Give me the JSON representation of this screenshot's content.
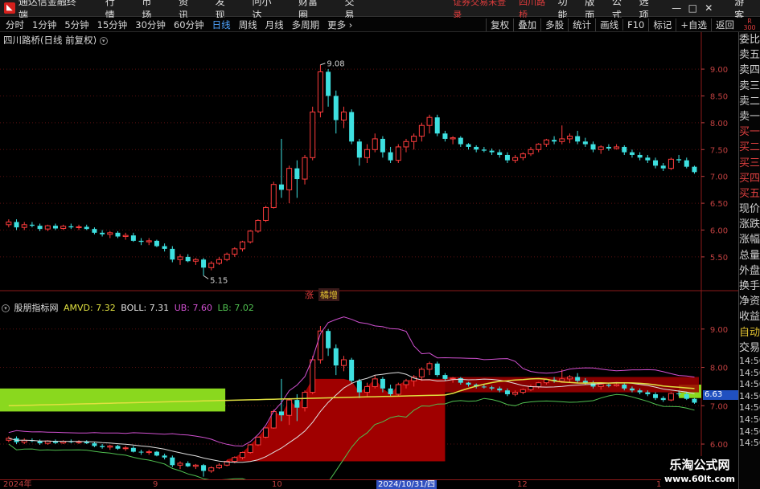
{
  "app": {
    "title": "通达信金融终端",
    "menus": [
      "行情",
      "市场",
      "资讯",
      "发现",
      "问小达",
      "财富圈",
      "交易"
    ],
    "status": "证券交易未登录",
    "stock_name": "四川路桥",
    "right_menus": [
      "功能",
      "版面",
      "公式",
      "选项"
    ],
    "window_controls": [
      "—",
      "□",
      "✕"
    ],
    "guest": "游客"
  },
  "periods": [
    "分时",
    "1分钟",
    "5分钟",
    "15分钟",
    "30分钟",
    "60分钟",
    "日线",
    "周线",
    "月线",
    "多周期",
    "更多 ›"
  ],
  "active_period": "日线",
  "tools": [
    "复权",
    "叠加",
    "多股",
    "统计",
    "画线",
    "F10",
    "标记",
    "+自选",
    "返回"
  ],
  "corner": {
    "top": "R",
    "bottom": "300"
  },
  "main_title": "四川路桥(日线 前复权)",
  "indicator": {
    "name": "股朋指标网",
    "amvd": "AMVD: 7.32",
    "boll": "BOLL: 7.31",
    "ub": "UB: 7.60",
    "lb": "LB: 7.02",
    "colors": {
      "name": "#e0e0e0",
      "amvd": "#e0e040",
      "boll": "#e0e0e0",
      "ub": "#d050d0",
      "lb": "#50c050"
    }
  },
  "badges": {
    "zhang": "涨",
    "nuoz": "橘增"
  },
  "current_price_label": "6.63",
  "right_panel": {
    "labels": [
      "委比",
      "卖五",
      "卖四",
      "卖三",
      "卖二",
      "卖一",
      "买一",
      "买二",
      "买三",
      "买四",
      "买五",
      "现价",
      "涨跌",
      "涨幅",
      "总量",
      "外盘",
      "换手",
      "净资",
      "收益"
    ],
    "auto": "自动",
    "trade": "交易",
    "times": [
      "14:56",
      "14:56",
      "14:56",
      "14:56",
      "14:56",
      "14:56",
      "14:56",
      "14:56"
    ]
  },
  "date_axis": {
    "ticks": [
      {
        "label": "2024年",
        "pos": 0.004
      },
      {
        "label": "9",
        "pos": 0.206
      },
      {
        "label": "10",
        "pos": 0.368
      },
      {
        "label": "12",
        "pos": 0.7
      },
      {
        "label": "1",
        "pos": 0.888
      }
    ],
    "cursor": "2024/10/31/四"
  },
  "watermark": {
    "title": "乐淘公式网",
    "url": "www.60lt.com"
  },
  "chart_data": {
    "type": "candlestick",
    "price_axis_main": {
      "ticks": [
        9.0,
        8.5,
        8.0,
        7.5,
        7.0,
        6.5,
        6.0,
        5.5
      ],
      "range": [
        4.9,
        9.45
      ]
    },
    "price_axis_ind": {
      "ticks": [
        9.0,
        8.0,
        7.0,
        6.0
      ],
      "range": [
        5.1,
        9.75
      ]
    },
    "annotations": {
      "high": "9.08",
      "low": "5.15"
    },
    "candles": [
      [
        6.1,
        6.2,
        6.05,
        6.15
      ],
      [
        6.15,
        6.2,
        6.0,
        6.05
      ],
      [
        6.05,
        6.15,
        6.0,
        6.1
      ],
      [
        6.1,
        6.15,
        6.05,
        6.08
      ],
      [
        6.08,
        6.12,
        5.98,
        6.02
      ],
      [
        6.02,
        6.1,
        5.98,
        6.08
      ],
      [
        6.08,
        6.12,
        6.0,
        6.03
      ],
      [
        6.03,
        6.1,
        6.0,
        6.07
      ],
      [
        6.07,
        6.12,
        6.02,
        6.05
      ],
      [
        6.05,
        6.1,
        6.0,
        6.06
      ],
      [
        6.06,
        6.1,
        6.0,
        6.02
      ],
      [
        6.02,
        6.05,
        5.92,
        5.95
      ],
      [
        5.95,
        6.0,
        5.88,
        5.92
      ],
      [
        5.92,
        5.98,
        5.85,
        5.95
      ],
      [
        5.95,
        5.98,
        5.85,
        5.88
      ],
      [
        5.88,
        5.95,
        5.82,
        5.9
      ],
      [
        5.9,
        5.95,
        5.78,
        5.8
      ],
      [
        5.8,
        5.85,
        5.72,
        5.78
      ],
      [
        5.78,
        5.85,
        5.72,
        5.8
      ],
      [
        5.8,
        5.82,
        5.68,
        5.7
      ],
      [
        5.7,
        5.75,
        5.6,
        5.65
      ],
      [
        5.65,
        5.7,
        5.4,
        5.45
      ],
      [
        5.45,
        5.55,
        5.35,
        5.5
      ],
      [
        5.5,
        5.55,
        5.4,
        5.42
      ],
      [
        5.42,
        5.48,
        5.35,
        5.45
      ],
      [
        5.45,
        5.48,
        5.15,
        5.3
      ],
      [
        5.3,
        5.42,
        5.25,
        5.38
      ],
      [
        5.38,
        5.5,
        5.35,
        5.45
      ],
      [
        5.45,
        5.58,
        5.42,
        5.55
      ],
      [
        5.55,
        5.68,
        5.5,
        5.65
      ],
      [
        5.65,
        5.8,
        5.6,
        5.78
      ],
      [
        5.78,
        6.0,
        5.75,
        5.98
      ],
      [
        5.98,
        6.2,
        5.95,
        6.18
      ],
      [
        6.18,
        6.45,
        6.15,
        6.42
      ],
      [
        6.42,
        6.9,
        6.4,
        6.85
      ],
      [
        6.85,
        7.7,
        6.6,
        6.75
      ],
      [
        6.75,
        7.2,
        6.5,
        7.15
      ],
      [
        7.15,
        7.3,
        6.6,
        6.95
      ],
      [
        6.95,
        7.4,
        6.85,
        7.35
      ],
      [
        7.35,
        8.3,
        7.3,
        8.2
      ],
      [
        8.2,
        9.08,
        8.1,
        8.95
      ],
      [
        8.95,
        9.0,
        8.3,
        8.5
      ],
      [
        8.5,
        8.6,
        7.8,
        8.05
      ],
      [
        8.05,
        8.3,
        7.9,
        8.2
      ],
      [
        8.2,
        8.25,
        7.6,
        7.65
      ],
      [
        7.65,
        7.7,
        7.2,
        7.35
      ],
      [
        7.35,
        7.6,
        7.25,
        7.5
      ],
      [
        7.5,
        7.8,
        7.45,
        7.7
      ],
      [
        7.7,
        7.75,
        7.35,
        7.45
      ],
      [
        7.45,
        7.55,
        7.25,
        7.3
      ],
      [
        7.3,
        7.6,
        7.25,
        7.55
      ],
      [
        7.55,
        7.7,
        7.45,
        7.65
      ],
      [
        7.65,
        7.8,
        7.5,
        7.75
      ],
      [
        7.75,
        8.0,
        7.65,
        7.95
      ],
      [
        7.95,
        8.15,
        7.8,
        8.1
      ],
      [
        8.1,
        8.15,
        7.75,
        7.8
      ],
      [
        7.8,
        7.85,
        7.65,
        7.7
      ],
      [
        7.7,
        7.75,
        7.6,
        7.72
      ],
      [
        7.72,
        7.75,
        7.55,
        7.6
      ],
      [
        7.6,
        7.62,
        7.5,
        7.55
      ],
      [
        7.55,
        7.58,
        7.45,
        7.5
      ],
      [
        7.5,
        7.55,
        7.45,
        7.48
      ],
      [
        7.48,
        7.52,
        7.4,
        7.45
      ],
      [
        7.45,
        7.5,
        7.35,
        7.4
      ],
      [
        7.4,
        7.45,
        7.25,
        7.3
      ],
      [
        7.3,
        7.4,
        7.25,
        7.35
      ],
      [
        7.35,
        7.45,
        7.3,
        7.42
      ],
      [
        7.42,
        7.55,
        7.38,
        7.5
      ],
      [
        7.5,
        7.62,
        7.45,
        7.6
      ],
      [
        7.6,
        7.7,
        7.55,
        7.68
      ],
      [
        7.68,
        7.75,
        7.6,
        7.65
      ],
      [
        7.65,
        7.95,
        7.6,
        7.7
      ],
      [
        7.7,
        7.8,
        7.62,
        7.75
      ],
      [
        7.75,
        7.85,
        7.6,
        7.65
      ],
      [
        7.65,
        7.72,
        7.55,
        7.6
      ],
      [
        7.6,
        7.65,
        7.45,
        7.5
      ],
      [
        7.5,
        7.58,
        7.42,
        7.55
      ],
      [
        7.55,
        7.6,
        7.48,
        7.52
      ],
      [
        7.52,
        7.6,
        7.5,
        7.55
      ],
      [
        7.55,
        7.58,
        7.4,
        7.45
      ],
      [
        7.45,
        7.5,
        7.35,
        7.4
      ],
      [
        7.4,
        7.45,
        7.3,
        7.35
      ],
      [
        7.35,
        7.4,
        7.25,
        7.3
      ],
      [
        7.3,
        7.35,
        7.15,
        7.2
      ],
      [
        7.2,
        7.25,
        7.1,
        7.15
      ],
      [
        7.15,
        7.35,
        7.12,
        7.32
      ],
      [
        7.32,
        7.4,
        7.25,
        7.3
      ],
      [
        7.3,
        7.35,
        7.15,
        7.18
      ],
      [
        7.18,
        7.2,
        7.05,
        7.08
      ]
    ]
  }
}
